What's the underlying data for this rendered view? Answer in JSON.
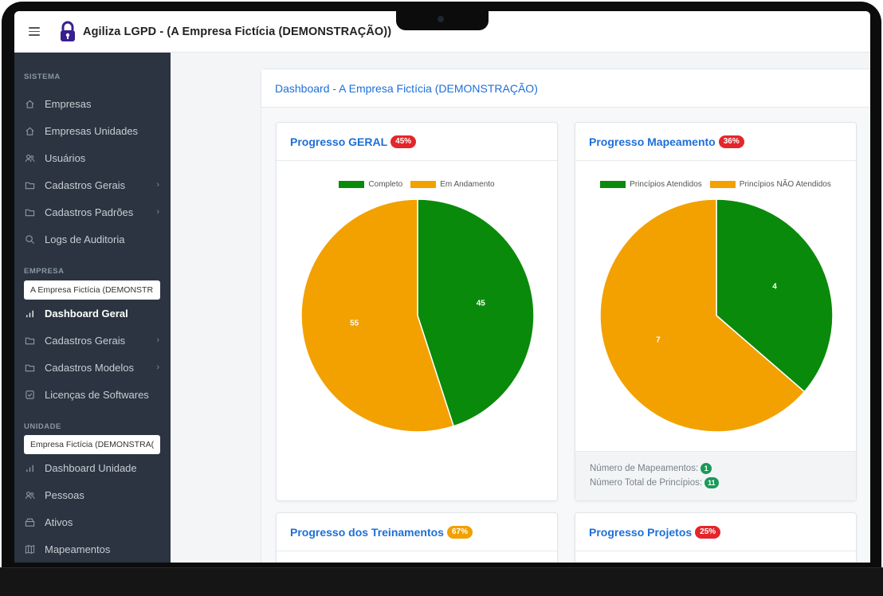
{
  "app": {
    "title": "Agiliza LGPD - (A Empresa Fictícia (DEMONSTRAÇÃO))"
  },
  "sidebar": {
    "sections": {
      "sistema": "SISTEMA",
      "empresa": "EMPRESA",
      "unidade": "UNIDADE"
    },
    "sistema_items": [
      {
        "label": "Empresas",
        "icon": "home-icon"
      },
      {
        "label": "Empresas Unidades",
        "icon": "home-icon"
      },
      {
        "label": "Usuários",
        "icon": "users-icon"
      },
      {
        "label": "Cadastros Gerais",
        "icon": "folder-icon"
      },
      {
        "label": "Cadastros Padrões",
        "icon": "folder-icon"
      },
      {
        "label": "Logs de Auditoria",
        "icon": "search-icon"
      }
    ],
    "empresa_selector": "A Empresa Fictícia (DEMONSTR",
    "empresa_items": [
      {
        "label": "Dashboard Geral",
        "icon": "bar-chart-icon"
      },
      {
        "label": "Cadastros Gerais",
        "icon": "folder-icon"
      },
      {
        "label": "Cadastros Modelos",
        "icon": "folder-icon"
      },
      {
        "label": "Licenças de Softwares",
        "icon": "checkbox-icon"
      }
    ],
    "unidade_selector": "Empresa Fictícia (DEMONSTRA(",
    "unidade_items": [
      {
        "label": "Dashboard Unidade",
        "icon": "bar-chart-icon"
      },
      {
        "label": "Pessoas",
        "icon": "users-icon"
      },
      {
        "label": "Ativos",
        "icon": "box-icon"
      },
      {
        "label": "Mapeamentos",
        "icon": "map-icon"
      }
    ]
  },
  "main": {
    "header": "Dashboard - A Empresa Fictícia (DEMONSTRAÇÃO)",
    "cards": {
      "geral": {
        "title": "Progresso GERAL",
        "badge": "45%",
        "badge_color": "#e3262b"
      },
      "mapeamento": {
        "title": "Progresso Mapeamento",
        "badge": "36%",
        "badge_color": "#e3262b",
        "footer_mapeamentos_label": "Número de Mapeamentos:",
        "footer_mapeamentos_value": "1",
        "footer_principios_label": "Número Total de Princípios:",
        "footer_principios_value": "11"
      },
      "treinamentos": {
        "title": "Progresso dos Treinamentos",
        "badge": "67%",
        "badge_color": "#f0a000"
      },
      "projetos": {
        "title": "Progresso Projetos",
        "badge": "25%",
        "badge_color": "#e3262b"
      }
    }
  },
  "colors": {
    "green": "#0a8a0a",
    "orange": "#f2a100",
    "accent_blue": "#1d6fd8"
  },
  "chart_data": [
    {
      "type": "pie",
      "title": "Progresso GERAL",
      "categories": [
        "Completo",
        "Em Andamento"
      ],
      "values": [
        45,
        55
      ],
      "colors": [
        "#0a8a0a",
        "#f2a100"
      ],
      "legend": "top"
    },
    {
      "type": "pie",
      "title": "Progresso Mapeamento",
      "categories": [
        "Princípios Atendidos",
        "Princípios NÃO Atendidos"
      ],
      "values": [
        4,
        7
      ],
      "colors": [
        "#0a8a0a",
        "#f2a100"
      ],
      "legend": "top"
    }
  ]
}
